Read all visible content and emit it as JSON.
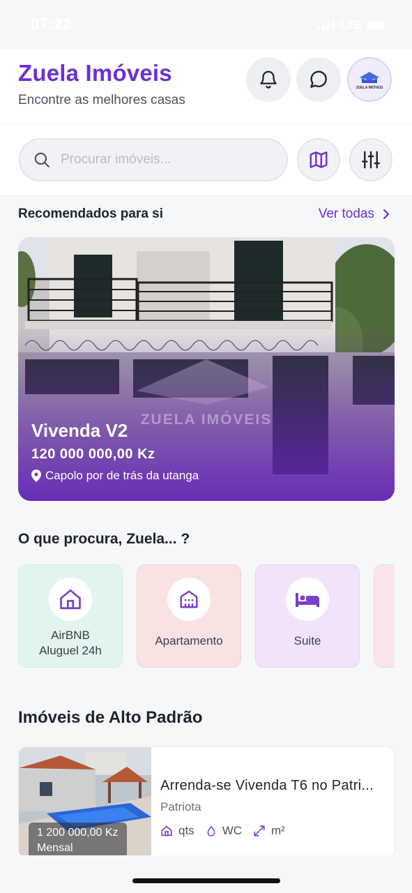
{
  "status_bar": {
    "time": "07:22",
    "network": "LTE"
  },
  "header": {
    "title": "Zuela Imóveis",
    "subtitle": "Encontre as melhores casas",
    "logo_text": "ZUELA IMÓVEIS"
  },
  "search": {
    "placeholder": "Procurar imóveis..."
  },
  "recommended": {
    "title": "Recomendados para si",
    "see_all": "Ver todas",
    "featured": {
      "name": "Vivenda V2",
      "price": "120 000 000,00 Kz",
      "location": "Capolo por de trás da utanga",
      "watermark": "ZUELA IMÓVEIS"
    }
  },
  "categories": {
    "title": "O que procura, Zuela... ?",
    "items": [
      {
        "label_line1": "AirBNB",
        "label_line2": "Aluguel 24h",
        "icon": "house-icon"
      },
      {
        "label_line1": "Apartamento",
        "label_line2": "",
        "icon": "building-icon"
      },
      {
        "label_line1": "Suite",
        "label_line2": "",
        "icon": "bed-icon"
      }
    ]
  },
  "premium": {
    "title": "Imóveis de Alto Padrão",
    "listing": {
      "price": "1 200 000,00 Kz",
      "period": "Mensal",
      "title": "Arrenda-se Vivenda T6 no Patri...",
      "location": "Patriota",
      "features": {
        "rooms": "qts",
        "bath": "WC",
        "area": "m²"
      }
    }
  },
  "colors": {
    "accent": "#6b2fd6",
    "background": "#f6f7f9"
  }
}
